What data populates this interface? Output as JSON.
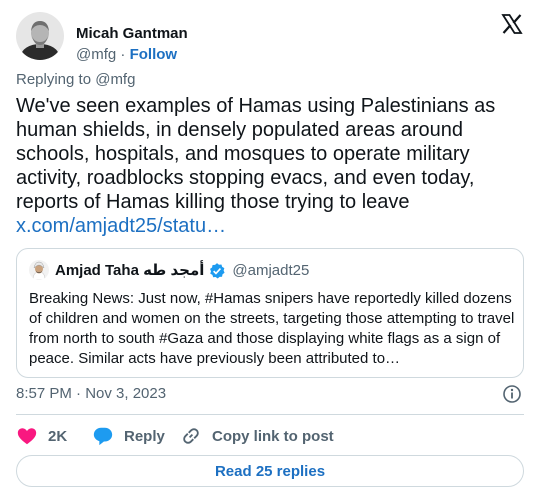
{
  "author": {
    "name": "Micah Gantman",
    "handle": "@mfg",
    "separator": "·",
    "follow_label": "Follow"
  },
  "reply_context": "Replying to @mfg",
  "tweet": {
    "text": "We've seen examples of Hamas using Palestinians as human shields, in densely populated areas around schools, hospitals, and mosques to operate military activity, roadblocks stopping evacs, and even today, reports of Hamas killing those trying to leave",
    "link": "x.com/amjadt25/statu…"
  },
  "quoted_tweet": {
    "name": "Amjad Taha أمجد طه",
    "handle": "@amjadt25",
    "text": "Breaking News: Just now, #Hamas snipers have reportedly killed dozens of children and women on the streets, targeting those attempting to travel from north to south #Gaza and those displaying white flags as a sign of peace. Similar acts have previously been attributed to…"
  },
  "timestamp": "8:57 PM · Nov 3, 2023",
  "actions": {
    "like_count": "2K",
    "reply_label": "Reply",
    "copy_label": "Copy link to post"
  },
  "read_replies_label": "Read 25 replies",
  "colors": {
    "link": "#1d70c2",
    "like": "#f91880",
    "reply": "#1d9bf0",
    "border": "#cfd9de",
    "muted": "#536471",
    "verified": "#1d9bf0"
  },
  "icons": [
    "x-logo-icon",
    "verified-badge-icon",
    "info-icon",
    "heart-icon",
    "reply-bubble-icon",
    "link-icon"
  ]
}
